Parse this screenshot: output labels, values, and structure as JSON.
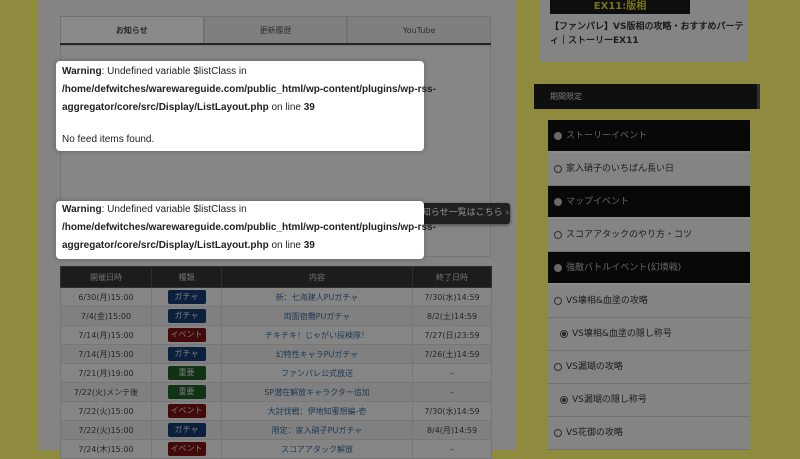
{
  "tabs": [
    "お知らせ",
    "更新履歴",
    "YouTube"
  ],
  "more_button": "お知らせ一覧はこちら ›",
  "warning1": {
    "label": "Warning",
    "msg": ": Undefined variable $listClass in",
    "path1": "/home/defwitches/warewareguide.com/public_html/wp-content/plugins/wp-rss-",
    "path2": "aggregator/core/src/Display/ListLayout.php",
    "online": " on line ",
    "line": "39",
    "nofeed": "No feed items found."
  },
  "warning2": {
    "label": "Warning",
    "msg": ": Undefined variable $listClass in",
    "path1": "/home/defwitches/warewareguide.com/public_html/wp-content/plugins/wp-rss-",
    "path2": "aggregator/core/src/Display/ListLayout.php",
    "online": " on line ",
    "line": "39"
  },
  "table": {
    "headers": [
      "開催日時",
      "種類",
      "内容",
      "終了日時"
    ],
    "rows": [
      {
        "start": "6/30(月)15:00",
        "type": "ガチャ",
        "kind": "gacha",
        "content": "新：七海建人PUガチャ",
        "end": "7/30(水)14:59"
      },
      {
        "start": "7/4(金)15:00",
        "type": "ガチャ",
        "kind": "gacha",
        "content": "両面宿儺PUガチャ",
        "end": "8/2(土)14:59"
      },
      {
        "start": "7/14(月)15:00",
        "type": "イベント",
        "kind": "event",
        "content": "チキチキ！じゃがい探検隊！",
        "end": "7/27(日)23:59"
      },
      {
        "start": "7/14(月)15:00",
        "type": "ガチャ",
        "kind": "gacha",
        "content": "幻特性キャラPUガチャ",
        "end": "7/26(土)14:59"
      },
      {
        "start": "7/21(月)19:00",
        "type": "重要",
        "kind": "imp",
        "content": "ファンパレ公式放送",
        "end": "–"
      },
      {
        "start": "7/22(火)メンテ後",
        "type": "重要",
        "kind": "imp",
        "content": "SP潜在解放キャラクター追加",
        "end": "–"
      },
      {
        "start": "7/22(火)15:00",
        "type": "イベント",
        "kind": "event",
        "content": "大討伐戦：伊地知蜜想編-壱",
        "end": "7/30(水)14:59"
      },
      {
        "start": "7/22(火)15:00",
        "type": "ガチャ",
        "kind": "gacha",
        "content": "限定：家入硝子PUガチャ",
        "end": "8/4(月)14:59"
      },
      {
        "start": "7/24(木)15:00",
        "type": "イベント",
        "kind": "event",
        "content": "スコアアタック解放",
        "end": "–"
      }
    ]
  },
  "sidebar": {
    "banner": "EX11:版相",
    "article_title": "【ファンパレ】VS版相の攻略・おすすめパーティ｜ストーリーEX11",
    "heading": "期間限定",
    "items": [
      {
        "label": "ストーリーイベント",
        "kind": "cat"
      },
      {
        "label": "家入硝子のいちばん長い日",
        "kind": "item"
      },
      {
        "label": "マップイベント",
        "kind": "cat"
      },
      {
        "label": "スコアアタックのやり方・コツ",
        "kind": "item"
      },
      {
        "label": "強敵バトルイベント(幻境戦)",
        "kind": "cat"
      },
      {
        "label": "VS壊相&血塗の攻略",
        "kind": "item"
      },
      {
        "label": "VS壊相&血塗の隠し称号",
        "kind": "sub"
      },
      {
        "label": "VS漏瑚の攻略",
        "kind": "item"
      },
      {
        "label": "VS漏瑚の隠し称号",
        "kind": "sub"
      },
      {
        "label": "VS花御の攻略",
        "kind": "item"
      }
    ]
  }
}
